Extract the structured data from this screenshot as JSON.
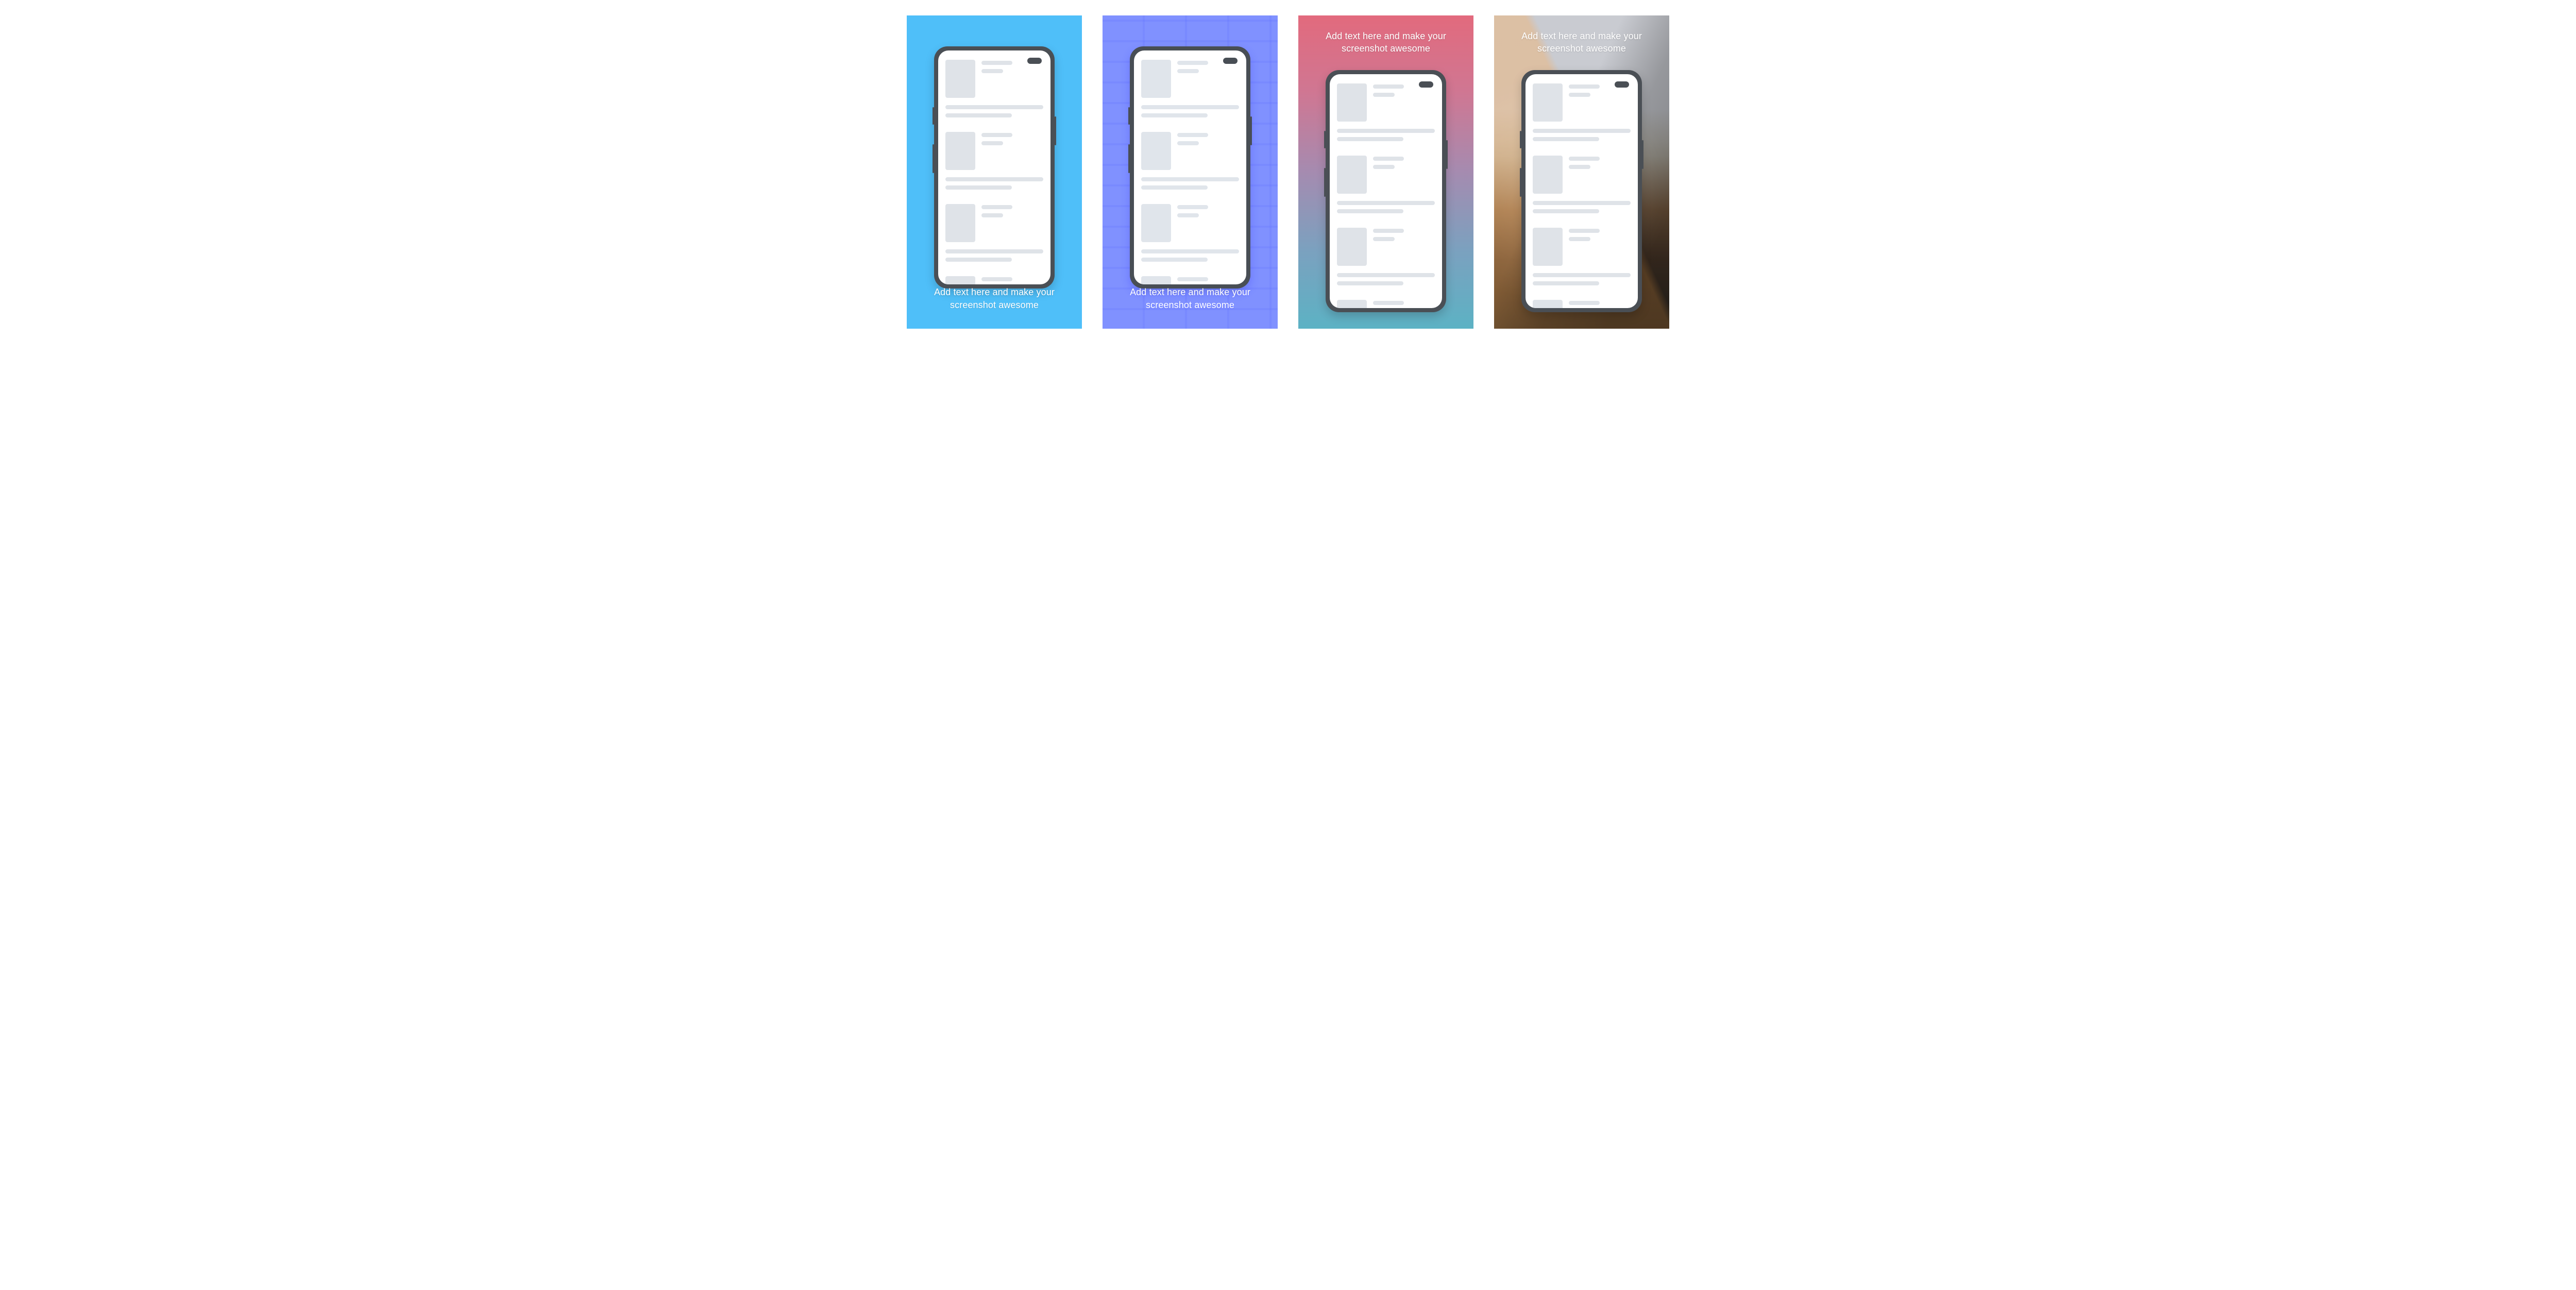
{
  "panels": [
    {
      "caption": "Add text here and make your screenshot awesome",
      "caption_position": "bottom",
      "background": "solid",
      "accent_color": "#4fbff9"
    },
    {
      "caption": "Add text here and make your screenshot awesome",
      "caption_position": "bottom",
      "background": "brick",
      "accent_color": "#8b97ff"
    },
    {
      "caption": "Add text here and make your screenshot awesome",
      "caption_position": "top",
      "background": "gradient",
      "accent_color_top": "#e26a7d",
      "accent_color_bottom": "#5cb2c4"
    },
    {
      "caption": "Add text here and make your screenshot awesome",
      "caption_position": "top",
      "background": "photo",
      "accent_color": "#6b5a46"
    }
  ],
  "phone": {
    "frame_color": "#4a4f55",
    "screen_color": "#ffffff",
    "placeholder_color": "#dfe3e8",
    "placeholder_rows": 4
  }
}
